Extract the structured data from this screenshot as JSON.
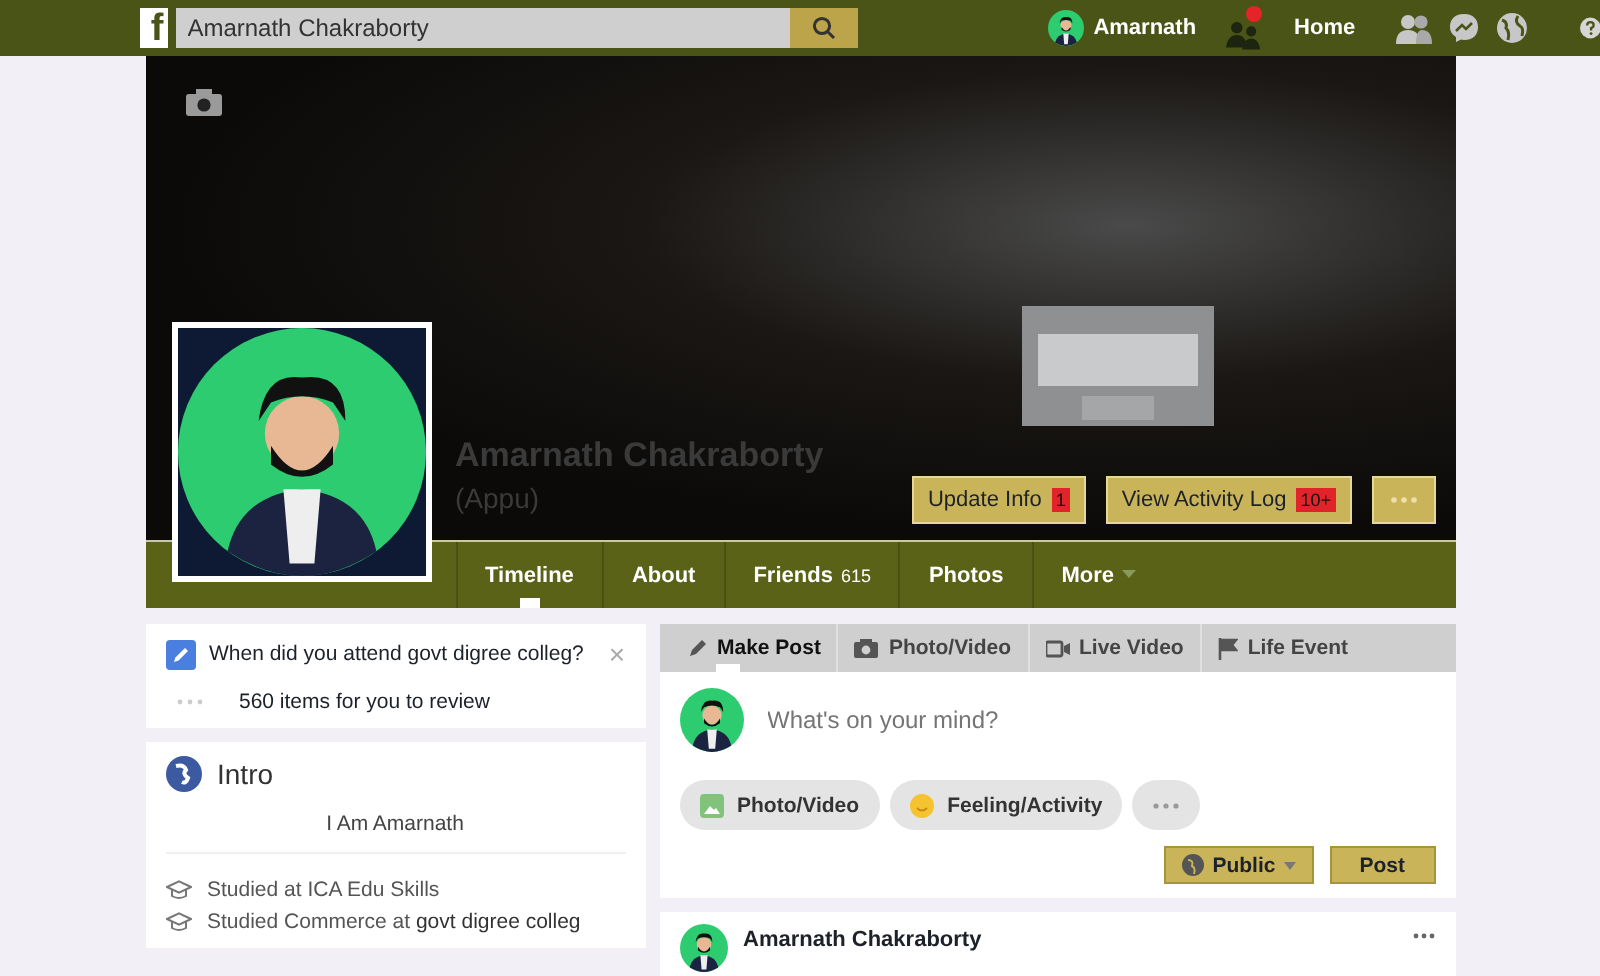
{
  "topbar": {
    "logo": "f",
    "search": {
      "value": "Amarnath Chakraborty"
    },
    "user_name": "Amarnath",
    "friend_requests_unread": true,
    "home_link": "Home"
  },
  "profile": {
    "name": "Amarnath Chakraborty",
    "nickname": "(Appu)",
    "buttons": [
      {
        "label": "Update Info",
        "badge": "1"
      },
      {
        "label": "View Activity Log",
        "badge": "10+"
      }
    ]
  },
  "tabs": [
    {
      "label": "Timeline",
      "selected": true,
      "has_menu": false
    },
    {
      "label": "About",
      "selected": false,
      "has_menu": false
    },
    {
      "label": "Friends",
      "count": "615",
      "selected": false,
      "has_menu": false
    },
    {
      "label": "Photos",
      "selected": false,
      "has_menu": false
    },
    {
      "label": "More",
      "selected": false,
      "has_menu": true
    }
  ],
  "prompt": {
    "question": "When did you attend govt digree colleg?",
    "close": "×",
    "review": "560 items for you to review"
  },
  "intro": {
    "title": "Intro",
    "bio": "I Am Amarnath",
    "items": [
      "Studied at ICA Edu Skills",
      "Studied Commerce at **govt digree colleg**"
    ]
  },
  "composer": {
    "tabs": [
      {
        "label": "Make Post",
        "kind": "pencil",
        "selected": true
      },
      {
        "label": "Photo/Video",
        "kind": "camera",
        "selected": false
      },
      {
        "label": "Live Video",
        "kind": "video",
        "selected": false
      },
      {
        "label": "Life Event",
        "kind": "flag",
        "selected": false
      }
    ],
    "placeholder": "What's on your mind?",
    "actions": [
      {
        "label": "Photo/Video",
        "kind": "photo"
      },
      {
        "label": "Feeling/Activity",
        "kind": "feeling"
      }
    ],
    "audience": "Public",
    "post_button": "Post"
  },
  "feed": [
    {
      "author": "Amarnath Chakraborty"
    }
  ]
}
